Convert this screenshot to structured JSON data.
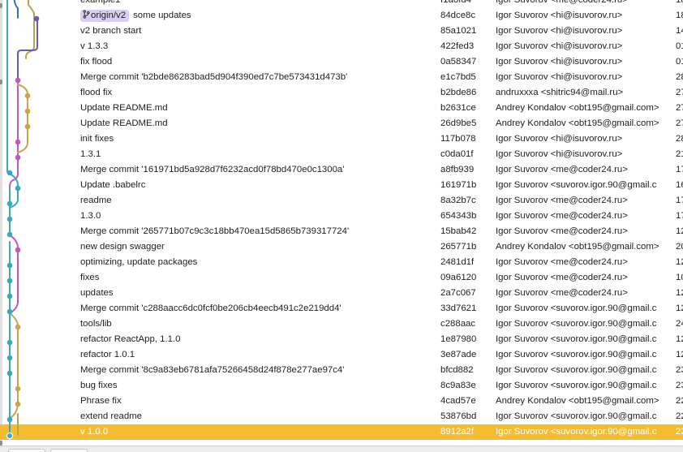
{
  "colors": {
    "selected_row": "#f6bc2f",
    "ref_tag_bg": "#d9cdf1",
    "lane_teal": "#39a9bd",
    "lane_olive": "#b7a546",
    "lane_purple": "#6d59b8",
    "lane_magenta": "#c258b7",
    "lane_blue": "#3b6fb5",
    "lane_gold": "#c6a64a"
  },
  "commits": [
    {
      "message": "example1",
      "hash": "f1a8fd4",
      "author": "Igor Suvorov <me@coder24.ru>",
      "date": "18"
    },
    {
      "ref": "origin/v2",
      "message": "some updates",
      "hash": "84dce8c",
      "author": "Igor Suvorov <hi@isuvorov.ru>",
      "date": "18"
    },
    {
      "message": "v2 branch start",
      "hash": "85a1021",
      "author": "Igor Suvorov <hi@isuvorov.ru>",
      "date": "14"
    },
    {
      "message": "v 1.3.3",
      "hash": "422fed3",
      "author": "Igor Suvorov <hi@isuvorov.ru>",
      "date": "01"
    },
    {
      "message": "fix flood",
      "hash": "0a58347",
      "author": "Igor Suvorov <hi@isuvorov.ru>",
      "date": "01"
    },
    {
      "message": "Merge commit 'b2bde86283bad5d904f390ed7c7be573431d473b'",
      "hash": "e1c7bd5",
      "author": "Igor Suvorov <hi@isuvorov.ru>",
      "date": "28"
    },
    {
      "message": "flood fix",
      "hash": "b2bde86",
      "author": "andruxxxa <shitric94@mail.ru>",
      "date": "27"
    },
    {
      "message": "Update README.md",
      "hash": "b2631ce",
      "author": "Andrey Kondalov <obt195@gmail.com>",
      "date": "27"
    },
    {
      "message": "Update README.md",
      "hash": "26d9be5",
      "author": "Andrey Kondalov <obt195@gmail.com>",
      "date": "27"
    },
    {
      "message": "init fixes",
      "hash": "117b078",
      "author": "Igor Suvorov <hi@isuvorov.ru>",
      "date": "28"
    },
    {
      "message": "1.3.1",
      "hash": "c0da01f",
      "author": "Igor Suvorov <hi@isuvorov.ru>",
      "date": "21"
    },
    {
      "message": "Merge commit '161971bd5a928d7f6232acd0f78bd470e0c1300a'",
      "hash": "a8fb939",
      "author": "Igor Suvorov <me@coder24.ru>",
      "date": "17"
    },
    {
      "message": "Update .babelrc",
      "hash": "161971b",
      "author": "Igor Suvorov <suvorov.igor.90@gmail.c",
      "date": "16"
    },
    {
      "message": "readme",
      "hash": "8a32b7c",
      "author": "Igor Suvorov <me@coder24.ru>",
      "date": "17"
    },
    {
      "message": "1.3.0",
      "hash": "654343b",
      "author": "Igor Suvorov <me@coder24.ru>",
      "date": "17"
    },
    {
      "message": "Merge commit '265771b07c9c3c18bb470ea15d5865b739317724'",
      "hash": "15bab42",
      "author": "Igor Suvorov <me@coder24.ru>",
      "date": "12"
    },
    {
      "message": "new design swagger",
      "hash": "265771b",
      "author": "Andrey Kondalov <obt195@gmail.com>",
      "date": "20"
    },
    {
      "message": "optimizing, update packages",
      "hash": "2481d1f",
      "author": "Igor Suvorov <me@coder24.ru>",
      "date": "12"
    },
    {
      "message": "fixes",
      "hash": "09a6120",
      "author": "Igor Suvorov <me@coder24.ru>",
      "date": "10"
    },
    {
      "message": "updates",
      "hash": "2a7c067",
      "author": "Igor Suvorov <me@coder24.ru>",
      "date": "12"
    },
    {
      "message": "Merge commit 'c288aacc6dc0fcf0be206cb4eecb491c2e219dd4'",
      "hash": "33d7621",
      "author": "Igor Suvorov <suvorov.igor.90@gmail.c",
      "date": "12"
    },
    {
      "message": "tools/lib",
      "hash": "c288aac",
      "author": "Igor Suvorov <suvorov.igor.90@gmail.c",
      "date": "24"
    },
    {
      "message": "refactor ReactApp, 1.1.0",
      "hash": "1e87980",
      "author": "Igor Suvorov <suvorov.igor.90@gmail.c",
      "date": "12"
    },
    {
      "message": "refactor 1.0.1",
      "hash": "3e87ade",
      "author": "Igor Suvorov <suvorov.igor.90@gmail.c",
      "date": "12"
    },
    {
      "message": "Merge commit '8c9a83eb6781afa75266458d24f878e277ae97c4'",
      "hash": "bfcd882",
      "author": "Igor Suvorov <suvorov.igor.90@gmail.c",
      "date": "23"
    },
    {
      "message": "bug fixes",
      "hash": "8c9a83e",
      "author": "Igor Suvorov <suvorov.igor.90@gmail.c",
      "date": "23"
    },
    {
      "message": "Phrase fix",
      "hash": "4cad57e",
      "author": "Andrey Kondalov <obt195@gmail.com>",
      "date": "22"
    },
    {
      "message": "extend readme",
      "hash": "53876bd",
      "author": "Igor Suvorov <suvorov.igor.90@gmail.c",
      "date": "22"
    },
    {
      "message": "v 1.0.0",
      "hash": "8912a2f",
      "author": "Igor Suvorov <suvorov.igor.90@gmail.c",
      "date": "22",
      "selected": true
    }
  ]
}
